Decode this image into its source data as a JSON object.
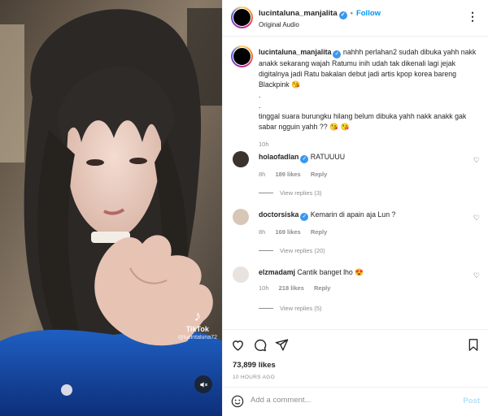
{
  "post": {
    "username": "lucintaluna_manjalita",
    "follow_label": "Follow",
    "audio": "Original Audio",
    "caption": {
      "username": "lucintaluna_manjalita",
      "line1": "nahhh perlahan2 sudah dibuka yahh nakk anakk sekarang wajah Ratumu inih udah tak dikenali lagi jejak digitalnya jadi Ratu bakalan debut jadi artis kpop korea bareng Blackpink 😘",
      "dot1": ".",
      "dot2": ".",
      "line2": "tinggal suara burungku hilang belum dibuka yahh nakk anakk gak sabar ngguin yahh ?? 😘 😘",
      "time": "10h"
    }
  },
  "comments": [
    {
      "username": "holaofadlan",
      "text": "RATUUUU",
      "time": "8h",
      "likes": "189 likes",
      "reply": "Reply",
      "replies": "View replies (3)"
    },
    {
      "username": "doctorsiska",
      "text": "Kemarin di apain aja Lun ?",
      "time": "8h",
      "likes": "169 likes",
      "reply": "Reply",
      "replies": "View replies (20)"
    },
    {
      "username": "elzmadamj",
      "text": "Cantik banget lho 😍",
      "time": "10h",
      "likes": "218 likes",
      "reply": "Reply",
      "replies": "View replies (5)"
    }
  ],
  "media": {
    "watermark_name": "TikTok",
    "watermark_handle": "@lucintaluna72"
  },
  "footer": {
    "likes": "73,899 likes",
    "ago": "10 HOURS AGO",
    "add_comment_placeholder": "Add a comment...",
    "post_label": "Post"
  },
  "icons": {
    "more": "more-horizontal-icon",
    "like": "heart-icon",
    "comment": "comment-icon",
    "share": "send-icon",
    "save": "bookmark-icon",
    "emoji": "emoji-icon",
    "mute": "muted-speaker-icon"
  },
  "colors": {
    "accent": "#0095f6",
    "verified": "#3897f0",
    "muted_text": "#8e8e8e",
    "post_disabled": "#b2dffc"
  }
}
